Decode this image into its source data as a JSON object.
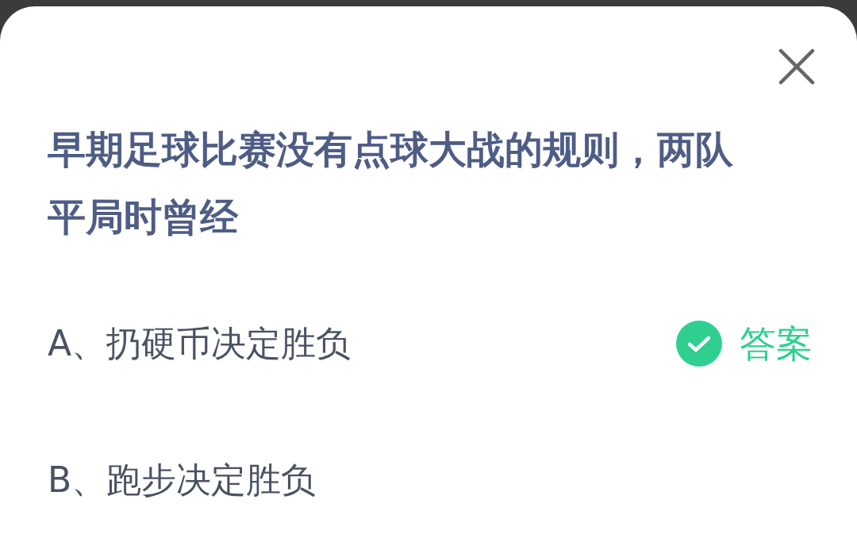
{
  "question": "早期足球比赛没有点球大战的规则，两队平局时曾经",
  "options": [
    {
      "text": "A、扔硬币决定胜负",
      "correct": true,
      "badge": "答案"
    },
    {
      "text": "B、跑步决定胜负",
      "correct": false
    }
  ]
}
